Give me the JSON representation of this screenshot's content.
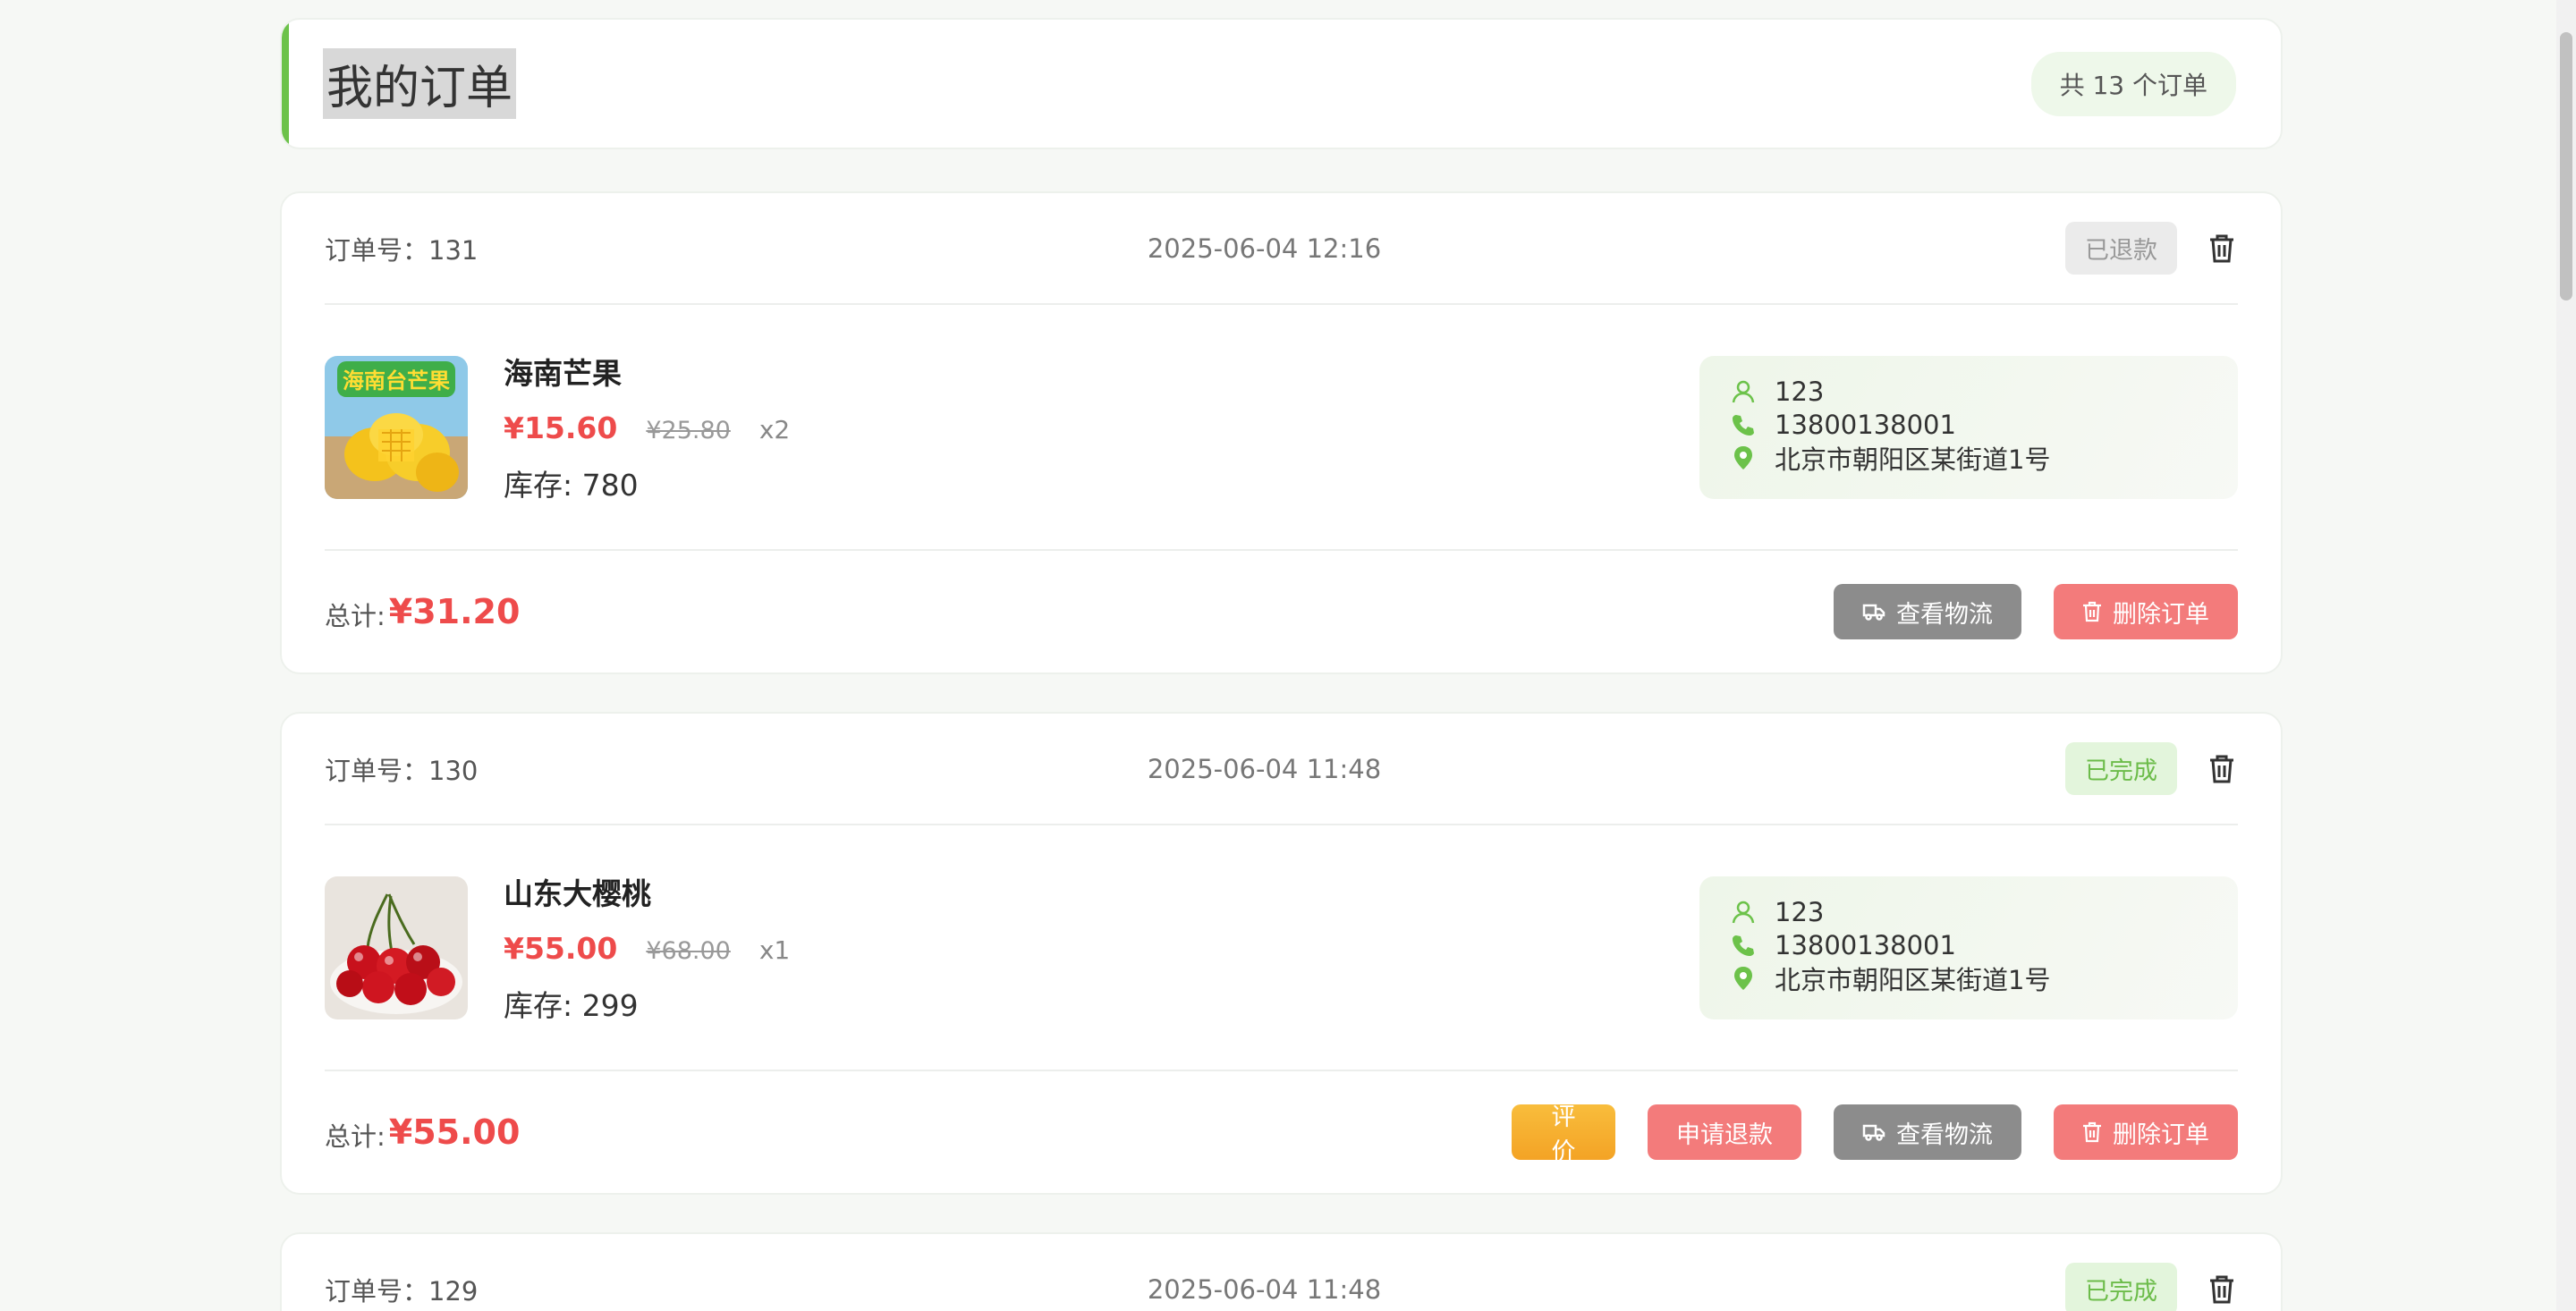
{
  "header": {
    "title": "我的订单",
    "count_label": "共 13 个订单"
  },
  "orders": [
    {
      "order_no": "订单号：131",
      "time": "2025-06-04 12:16",
      "status": "已退款",
      "product_name": "海南芒果",
      "price": "¥15.60",
      "old_price": "¥25.80",
      "qty": "x2",
      "stock": "库存: 780",
      "receiver": "123",
      "phone": "13800138001",
      "address": "北京市朝阳区某街道1号",
      "total_label": "总计:",
      "total": "¥31.20",
      "btn_logistics": "查看物流",
      "btn_delete": "删除订单"
    },
    {
      "order_no": "订单号：130",
      "time": "2025-06-04 11:48",
      "status": "已完成",
      "product_name": "山东大樱桃",
      "price": "¥55.00",
      "old_price": "¥68.00",
      "qty": "x1",
      "stock": "库存: 299",
      "receiver": "123",
      "phone": "13800138001",
      "address": "北京市朝阳区某街道1号",
      "total_label": "总计:",
      "total": "¥55.00",
      "btn_review": "评价",
      "btn_refund": "申请退款",
      "btn_logistics": "查看物流",
      "btn_delete": "删除订单"
    },
    {
      "order_no": "订单号：129",
      "time": "2025-06-04 11:48",
      "status": "已完成"
    }
  ],
  "mango_image_text": {
    "line1": "海南台芒果"
  },
  "colors": {
    "accent_green": "#6cc24a",
    "price_red": "#ee4b4b",
    "status_refunded_bg": "#ebebeb",
    "status_done_bg": "#e3f5dc",
    "btn_gray": "#8c8c8c",
    "btn_red": "#f37b7b",
    "btn_orange": "#f4a325"
  }
}
